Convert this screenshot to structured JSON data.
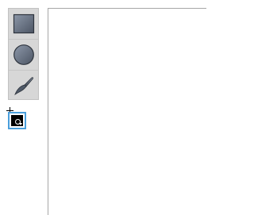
{
  "toolbar": {
    "tools": [
      {
        "name": "rectangle",
        "icon": "rectangle-icon"
      },
      {
        "name": "ellipse",
        "icon": "circle-icon"
      },
      {
        "name": "brush",
        "icon": "brush-icon"
      }
    ]
  },
  "color_picker": {
    "current_color": "#000000",
    "selection_border_color": "#4a9fdc"
  },
  "colors": {
    "panel_background": "#d7d7d7",
    "icon_fill_dark": "#4f5968",
    "icon_fill_light": "#7c8797",
    "canvas_border": "#a7a7a7"
  }
}
